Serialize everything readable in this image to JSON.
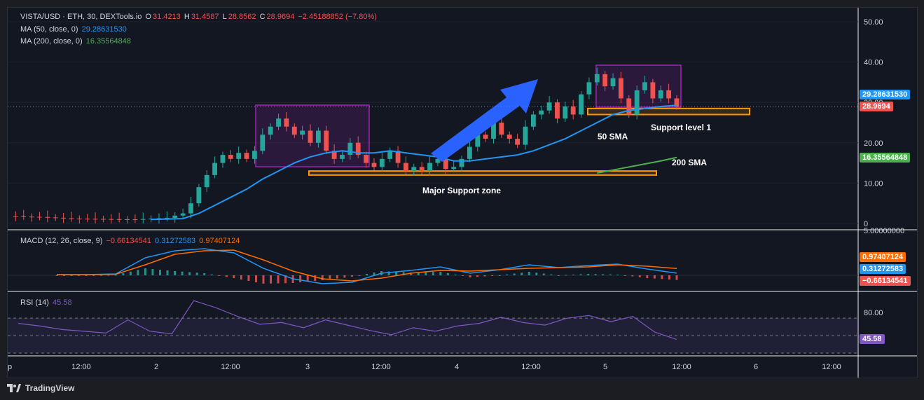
{
  "header": {
    "symbol": "VISTA/USD · ETH, 30, DEXTools.io",
    "o_label": "O",
    "o": "31.4213",
    "h_label": "H",
    "h": "31.4587",
    "l_label": "L",
    "l": "28.8562",
    "c_label": "C",
    "c": "28.9694",
    "change": "−2.45188852 (−7.80%)",
    "ma50_label": "MA (50, close, 0)",
    "ma50_value": "29.28631530",
    "ma200_label": "MA (200, close, 0)",
    "ma200_value": "16.35564848"
  },
  "price_axis": {
    "ticks": [
      "50.00",
      "40.00",
      "30.00",
      "20.00",
      "10.00",
      "0"
    ],
    "ma50_tag": "29.28631530",
    "last_tag": "28.9694",
    "ma200_tag": "16.35564848"
  },
  "macd": {
    "label": "MACD (12, 26, close, 9)",
    "hist": "−0.66134541",
    "macd": "0.31272583",
    "signal": "0.97407124",
    "axis_top": "5.00000000",
    "tag_signal": "0.97407124",
    "tag_macd": "0.31272583",
    "tag_hist": "−0.66134541"
  },
  "rsi": {
    "label": "RSI (14)",
    "value": "45.58",
    "axis_tick": "80.00",
    "tag": "45.58"
  },
  "time_axis": [
    "p",
    "12:00",
    "2",
    "12:00",
    "3",
    "12:00",
    "4",
    "12:00",
    "5",
    "12:00",
    "6",
    "12:00"
  ],
  "annotations": {
    "support1": "Support level 1",
    "sma50": "50 SMA",
    "sma200": "200 SMA",
    "major_support": "Major Support zone"
  },
  "footer": {
    "brand": "TradingView"
  },
  "colors": {
    "up": "#26a69a",
    "down": "#ef5350",
    "ma50": "#2196f3",
    "ma200": "#4caf50",
    "zone": "#ff9800",
    "box": "#9c27b0",
    "arrow": "#2962ff",
    "rsi": "#7e57c2",
    "signal": "#ff6d00"
  },
  "chart_data": {
    "type": "candlestick",
    "timeframe": "30",
    "x_ticks": [
      "12:00",
      "2",
      "12:00",
      "3",
      "12:00",
      "4",
      "12:00",
      "5",
      "12:00",
      "6",
      "12:00"
    ],
    "ylim": [
      0,
      50
    ],
    "last_close": 28.9694,
    "ma50_last": 29.2863153,
    "ma200_last": 16.35564848,
    "close_path": [
      [
        0,
        1.8
      ],
      [
        4,
        1.6
      ],
      [
        8,
        1.2
      ],
      [
        12,
        1.1
      ],
      [
        16,
        1.0
      ],
      [
        18,
        1.2
      ],
      [
        20,
        1.4
      ],
      [
        22,
        2.5
      ],
      [
        23,
        5
      ],
      [
        24,
        9
      ],
      [
        25,
        12
      ],
      [
        26,
        15
      ],
      [
        27,
        17
      ],
      [
        28,
        16
      ],
      [
        29,
        17.5
      ],
      [
        30,
        16
      ],
      [
        31,
        18
      ],
      [
        32,
        22
      ],
      [
        33,
        24
      ],
      [
        34,
        26
      ],
      [
        35,
        24
      ],
      [
        36,
        22
      ],
      [
        37,
        23
      ],
      [
        38,
        20
      ],
      [
        39,
        23
      ],
      [
        40,
        18
      ],
      [
        41,
        16
      ],
      [
        42,
        17
      ],
      [
        43,
        20
      ],
      [
        44,
        17
      ],
      [
        45,
        15
      ],
      [
        46,
        14
      ],
      [
        47,
        16
      ],
      [
        48,
        18
      ],
      [
        49,
        15
      ],
      [
        50,
        13
      ],
      [
        51,
        14
      ],
      [
        52,
        13
      ],
      [
        53,
        15
      ],
      [
        54,
        16
      ],
      [
        55,
        13.5
      ],
      [
        56,
        14
      ],
      [
        57,
        16
      ],
      [
        58,
        19
      ],
      [
        59,
        22
      ],
      [
        60,
        21
      ],
      [
        61,
        25
      ],
      [
        62,
        22
      ],
      [
        63,
        21
      ],
      [
        64,
        19.5
      ],
      [
        65,
        24
      ],
      [
        66,
        27
      ],
      [
        67,
        28
      ],
      [
        68,
        30
      ],
      [
        69,
        26
      ],
      [
        70,
        29
      ],
      [
        71,
        27
      ],
      [
        72,
        32
      ],
      [
        73,
        35
      ],
      [
        74,
        37
      ],
      [
        75,
        34
      ],
      [
        76,
        36
      ],
      [
        77,
        31
      ],
      [
        78,
        27
      ],
      [
        79,
        33
      ],
      [
        80,
        35
      ],
      [
        81,
        31
      ],
      [
        82,
        33
      ],
      [
        83,
        31
      ],
      [
        84,
        28.97
      ]
    ],
    "ma50_path": [
      [
        18,
        1.0
      ],
      [
        22,
        1.2
      ],
      [
        24,
        2.5
      ],
      [
        26,
        4.5
      ],
      [
        28,
        6.5
      ],
      [
        30,
        8.5
      ],
      [
        32,
        11
      ],
      [
        34,
        13
      ],
      [
        36,
        15
      ],
      [
        38,
        16.5
      ],
      [
        40,
        17.5
      ],
      [
        42,
        18
      ],
      [
        44,
        17.5
      ],
      [
        46,
        17.5
      ],
      [
        48,
        18
      ],
      [
        50,
        17.5
      ],
      [
        52,
        17
      ],
      [
        54,
        16.5
      ],
      [
        56,
        15.5
      ],
      [
        58,
        15.5
      ],
      [
        60,
        16
      ],
      [
        62,
        16.5
      ],
      [
        64,
        17
      ],
      [
        66,
        18
      ],
      [
        68,
        19.5
      ],
      [
        70,
        21
      ],
      [
        72,
        23
      ],
      [
        74,
        25
      ],
      [
        76,
        27
      ],
      [
        78,
        28
      ],
      [
        80,
        28.5
      ],
      [
        82,
        29
      ],
      [
        84,
        29.29
      ]
    ],
    "ma200_path": [
      [
        74,
        12.5
      ],
      [
        78,
        14
      ],
      [
        82,
        15.5
      ],
      [
        84,
        16.36
      ]
    ],
    "support_zones": [
      {
        "name": "Support level 1",
        "from": 27.0,
        "to": 28.5
      },
      {
        "name": "Major Support zone",
        "from": 12.0,
        "to": 13.0
      }
    ],
    "macd_ylim": [
      -2,
      5
    ],
    "macd_series": {
      "macd": [
        0.1,
        0.1,
        0.2,
        2.5,
        3.5,
        3.8,
        3.2,
        1.0,
        -0.5,
        -1.2,
        -1.0,
        0.3,
        0.7,
        1.2,
        0.3,
        0.8,
        1.5,
        1.1,
        1.4,
        1.6,
        0.9,
        0.31
      ],
      "signal": [
        0.1,
        0.1,
        0.15,
        1.5,
        3.0,
        3.5,
        3.6,
        2.2,
        0.6,
        -0.5,
        -0.8,
        -0.4,
        0.3,
        0.7,
        0.6,
        0.8,
        1.0,
        1.1,
        1.2,
        1.5,
        1.3,
        0.97
      ],
      "histogram": [
        0,
        0,
        0.05,
        1.0,
        0.6,
        0.3,
        -0.4,
        -1.2,
        -1.1,
        -0.7,
        -0.2,
        0.6,
        0.4,
        0.5,
        -0.3,
        0.0,
        0.5,
        0.0,
        0.2,
        0.1,
        -0.4,
        -0.66
      ]
    },
    "rsi_ylim": [
      30,
      95
    ],
    "rsi_values": [
      64,
      61,
      57,
      55,
      53,
      68,
      55,
      52,
      90,
      82,
      72,
      63,
      65,
      59,
      68,
      62,
      56,
      51,
      59,
      55,
      61,
      64,
      71,
      65,
      62,
      70,
      73,
      66,
      72,
      54,
      45.58
    ]
  }
}
